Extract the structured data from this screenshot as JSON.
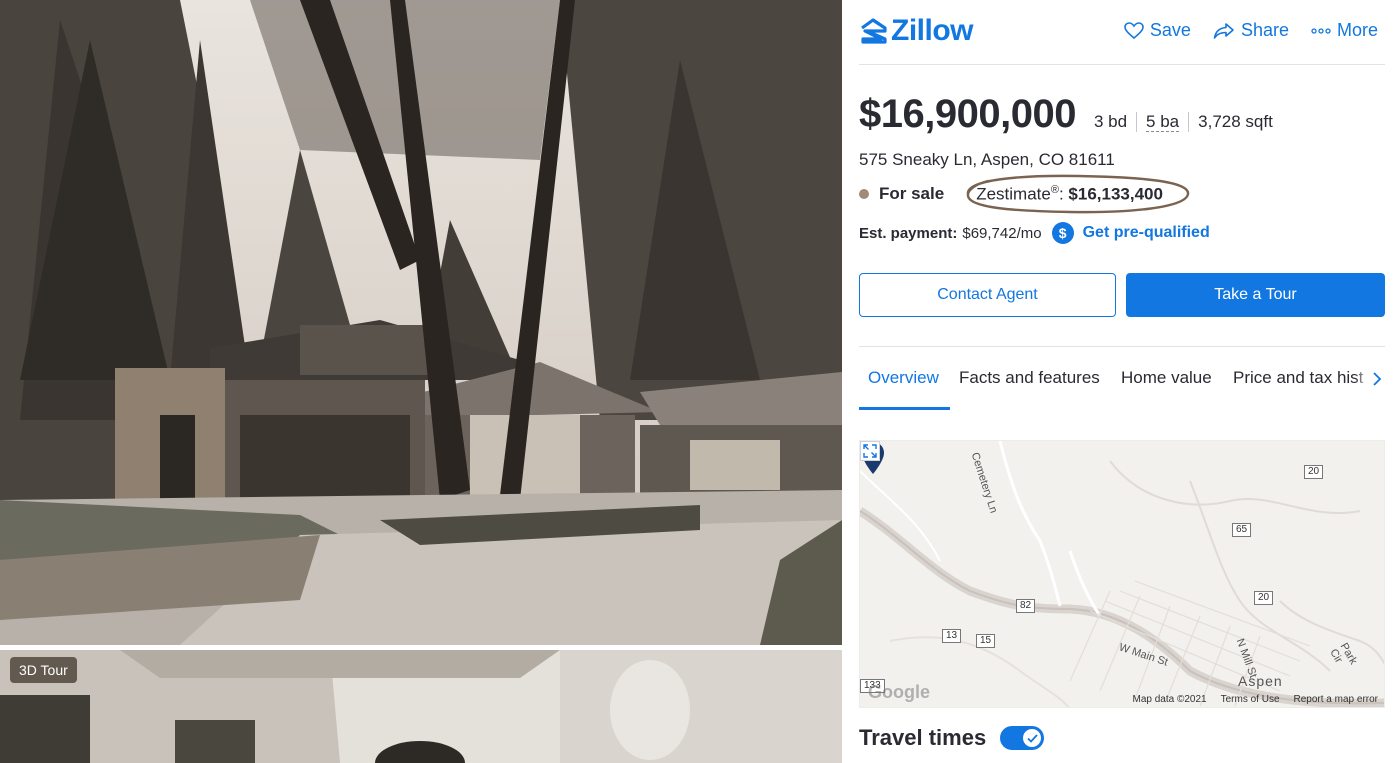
{
  "brand": {
    "name": "Zillow",
    "color": "#1277e1"
  },
  "header_actions": [
    {
      "label": "Save",
      "icon": "heart-icon"
    },
    {
      "label": "Share",
      "icon": "share-icon"
    },
    {
      "label": "More",
      "icon": "more-dots-icon"
    }
  ],
  "photos": {
    "tour_badge": "3D Tour"
  },
  "listing": {
    "price": "$16,900,000",
    "beds": "3 bd",
    "baths": "5 ba",
    "sqft": "3,728 sqft",
    "address": "575 Sneaky Ln, Aspen, CO 81611",
    "status": "For sale",
    "status_dot_color": "#a08a78",
    "zestimate_label": "Zestimate",
    "zestimate_mark": "®",
    "zestimate_sep": ":",
    "zestimate_value": "$16,133,400",
    "payment_label": "Est. payment:",
    "payment_value": "$69,742/mo",
    "prequal_icon": "$",
    "prequal_label": "Get pre-qualified"
  },
  "buttons": {
    "contact": "Contact Agent",
    "tour": "Take a Tour"
  },
  "tabs": [
    "Overview",
    "Facts and features",
    "Home value",
    "Price and tax hist"
  ],
  "map": {
    "labels": {
      "street1": "Cemetery Ln",
      "street2": "W Main St",
      "street3": "N Mill St",
      "street4": "Park Cir",
      "town": "Aspen",
      "google": "Google"
    },
    "highways": [
      "20",
      "65",
      "82",
      "13",
      "15",
      "20",
      "133"
    ],
    "footer": {
      "data": "Map data ©2021",
      "terms": "Terms of Use",
      "report": "Report a map error"
    }
  },
  "travel": {
    "title": "Travel times",
    "enabled": true
  }
}
